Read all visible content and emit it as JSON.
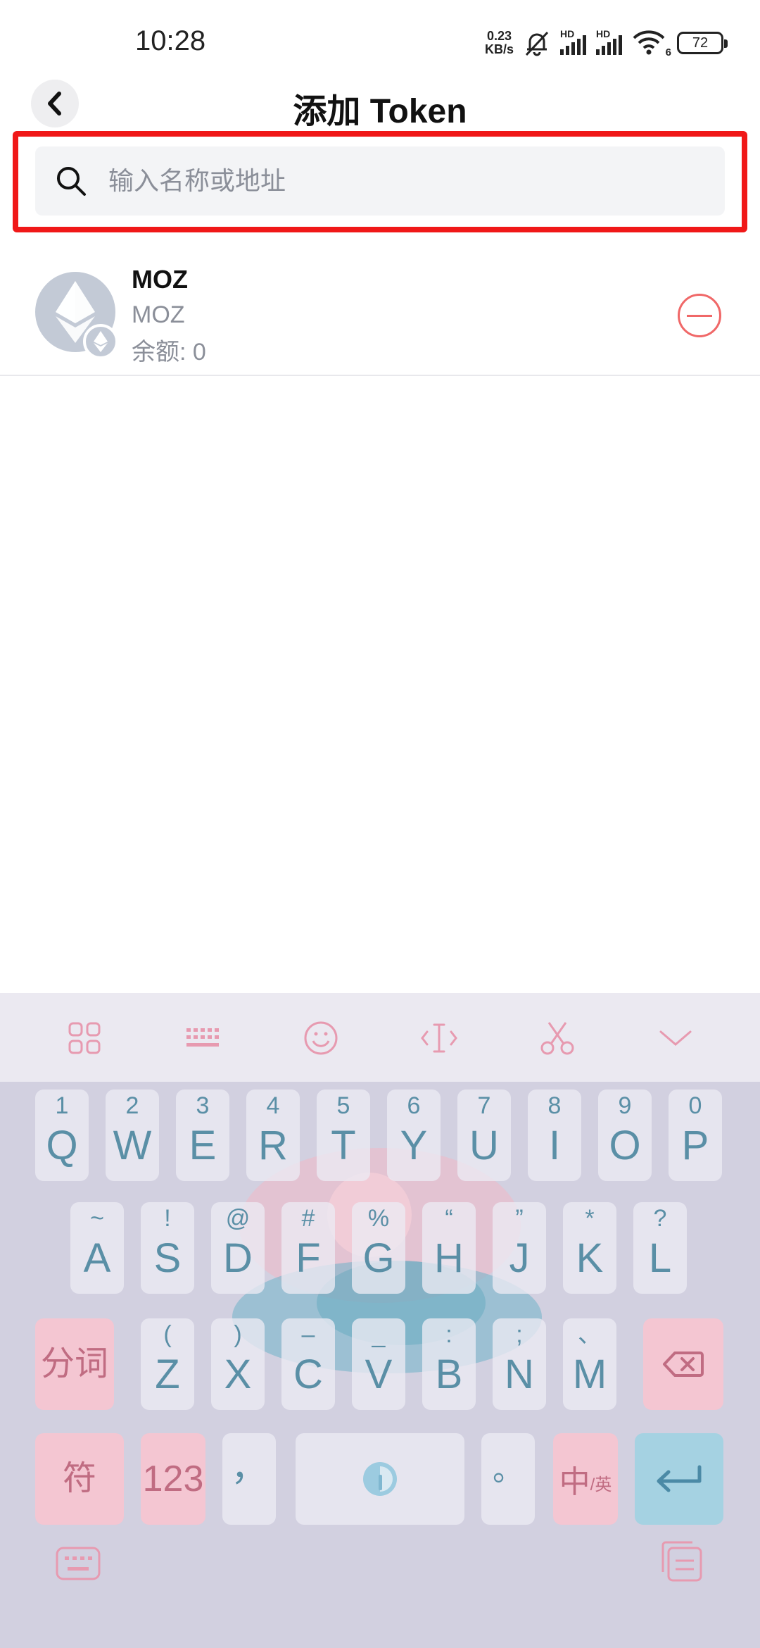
{
  "status_bar": {
    "time": "10:28",
    "net_speed_value": "0.23",
    "net_speed_unit": "KB/s",
    "signal_label_1": "HD",
    "signal_label_2": "HD",
    "wifi_label": "6",
    "battery": "72"
  },
  "header": {
    "title": "添加 Token",
    "back_icon": "chevron-left-icon"
  },
  "search": {
    "placeholder": "输入名称或地址",
    "value": "",
    "icon": "search-icon",
    "highlight_color": "#f01818"
  },
  "tokens": [
    {
      "name": "MOZ",
      "symbol": "MOZ",
      "balance_label": "余额:",
      "balance": "0",
      "icon": "ethereum-icon",
      "action_icon": "remove-circle-icon"
    }
  ],
  "keyboard": {
    "toolbar": [
      "apps-grid-icon",
      "keyboard-layout-icon",
      "emoji-icon",
      "cursor-icon",
      "scissors-icon",
      "collapse-chevron-icon"
    ],
    "row1": [
      {
        "main": "Q",
        "sub": "1"
      },
      {
        "main": "W",
        "sub": "2"
      },
      {
        "main": "E",
        "sub": "3"
      },
      {
        "main": "R",
        "sub": "4"
      },
      {
        "main": "T",
        "sub": "5"
      },
      {
        "main": "Y",
        "sub": "6"
      },
      {
        "main": "U",
        "sub": "7"
      },
      {
        "main": "I",
        "sub": "8"
      },
      {
        "main": "O",
        "sub": "9"
      },
      {
        "main": "P",
        "sub": "0"
      }
    ],
    "row2": [
      {
        "main": "A",
        "sub": "~"
      },
      {
        "main": "S",
        "sub": "!"
      },
      {
        "main": "D",
        "sub": "@"
      },
      {
        "main": "F",
        "sub": "#"
      },
      {
        "main": "G",
        "sub": "%"
      },
      {
        "main": "H",
        "sub": "“"
      },
      {
        "main": "J",
        "sub": "”"
      },
      {
        "main": "K",
        "sub": "*"
      },
      {
        "main": "L",
        "sub": "?"
      }
    ],
    "row3": [
      {
        "main": "Z",
        "sub": "("
      },
      {
        "main": "X",
        "sub": ")"
      },
      {
        "main": "C",
        "sub": "–"
      },
      {
        "main": "V",
        "sub": "_"
      },
      {
        "main": "B",
        "sub": ":"
      },
      {
        "main": "N",
        "sub": ";"
      },
      {
        "main": "M",
        "sub": "、"
      }
    ],
    "split_word": "分词",
    "symbols": "符",
    "numbers": "123",
    "comma": "，",
    "period": "。",
    "lang_main": "中",
    "lang_sub": "/英",
    "space_icon": "mic-logo-icon",
    "backspace_icon": "backspace-icon",
    "enter_icon": "enter-icon"
  },
  "navbar": {
    "left_icon": "keyboard-switch-icon",
    "right_icon": "clipboard-icon"
  }
}
